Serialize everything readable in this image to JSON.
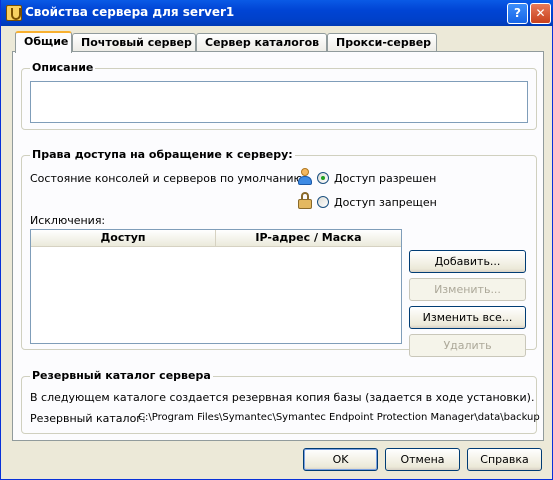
{
  "window": {
    "title": "Свойства сервера для server1",
    "help_button": "?",
    "close_button": "✕"
  },
  "tabs": [
    {
      "label": "Общие",
      "active": true
    },
    {
      "label": "Почтовый сервер",
      "active": false
    },
    {
      "label": "Сервер каталогов",
      "active": false
    },
    {
      "label": "Прокси-сервер",
      "active": false
    }
  ],
  "description": {
    "title": "Описание",
    "value": ""
  },
  "access": {
    "title": "Права доступа на обращение к серверу:",
    "default_state_label": "Состояние консолей и серверов по умолчанию:",
    "option_allowed": "Доступ разрешен",
    "option_denied": "Доступ запрещен",
    "selected": "allowed",
    "exceptions_label": "Исключения:",
    "columns": [
      "Доступ",
      "IP-адрес / Маска"
    ],
    "rows": [],
    "buttons": {
      "add": "Добавить...",
      "edit": "Изменить...",
      "edit_all": "Изменить все...",
      "delete": "Удалить"
    }
  },
  "backup": {
    "title": "Резервный каталог сервера",
    "info": "В следующем каталоге создается резервная копия базы (задается в ходе установки).",
    "path_label": "Резервный каталог:",
    "path_value": "C:\\Program Files\\Symantec\\Symantec Endpoint Protection Manager\\data\\backup"
  },
  "footer": {
    "ok": "OK",
    "cancel": "Отмена",
    "help": "Справка"
  }
}
